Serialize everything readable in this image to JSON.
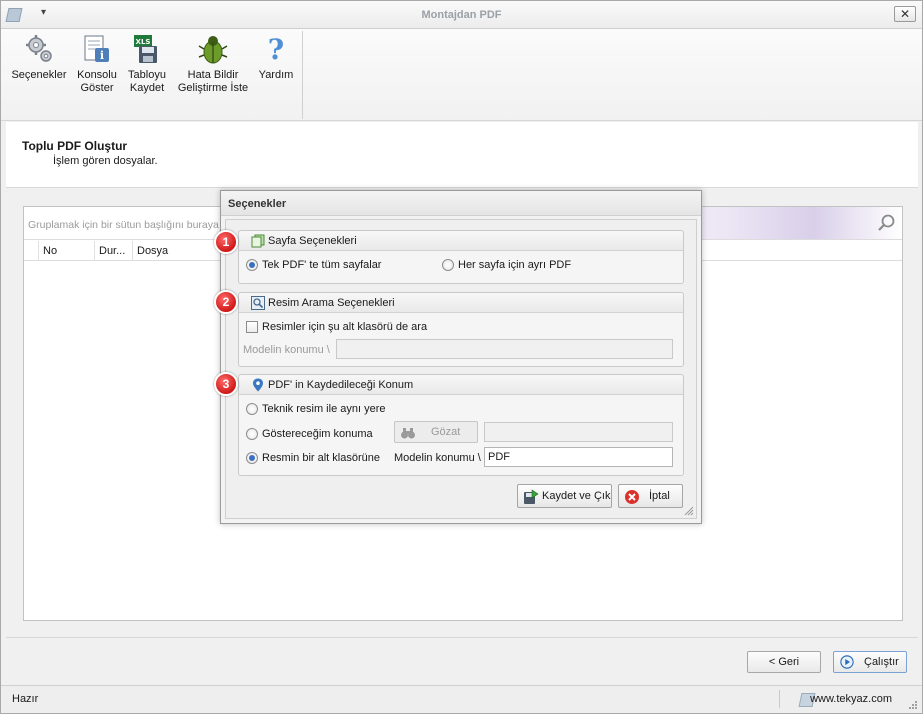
{
  "window": {
    "title": "Montajdan PDF",
    "close_label": "✕",
    "qat_label": "▾"
  },
  "ribbon": {
    "items": [
      {
        "label_line1": "Seçenekler",
        "label_line2": ""
      },
      {
        "label_line1": "Konsolu",
        "label_line2": "Göster"
      },
      {
        "label_line1": "Tabloyu",
        "label_line2": "Kaydet"
      },
      {
        "label_line1": "Hata Bildir",
        "label_line2": "Geliştirme İste"
      },
      {
        "label_line1": "Yardım",
        "label_line2": ""
      }
    ]
  },
  "header": {
    "title": "Toplu PDF Oluştur",
    "subtitle": "İşlem gören dosyalar."
  },
  "grid": {
    "group_hint": "Gruplamak için bir sütun başlığını buraya",
    "columns": [
      "No",
      "Dur...",
      "Dosya"
    ]
  },
  "navigation": {
    "back_label": "< Geri",
    "run_label": "Çalıştır"
  },
  "status": {
    "ready": "Hazır",
    "website": "www.tekyaz.com"
  },
  "dialog": {
    "title": "Seçenekler",
    "page_group": {
      "badge": "1",
      "title": "Sayfa Seçenekleri",
      "option_single": "Tek PDF' te tüm sayfalar",
      "option_separate": "Her sayfa için ayrı PDF"
    },
    "search_group": {
      "badge": "2",
      "title": "Resim Arama Seçenekleri",
      "subfolder_check": "Resimler için şu alt klasörü de ara",
      "model_location_label": "Modelin konumu \\",
      "model_location_value": ""
    },
    "save_group": {
      "badge": "3",
      "title": "PDF' in Kaydedileceği Konum",
      "option_same": "Teknik resim ile aynı yere",
      "option_custom": "Göstereceğim konuma",
      "browse_label": "Gözat",
      "custom_path_value": "",
      "option_subfolder": "Resmin bir alt klasörüne",
      "model_location_label": "Modelin konumu \\",
      "subfolder_value": "PDF"
    },
    "save_exit_label": "Kaydet ve Çık",
    "cancel_label": "İptal"
  },
  "colors": {
    "badge_red": "#d01818",
    "radio_blue": "#3b6fc2",
    "accent": "#2d6db5"
  }
}
